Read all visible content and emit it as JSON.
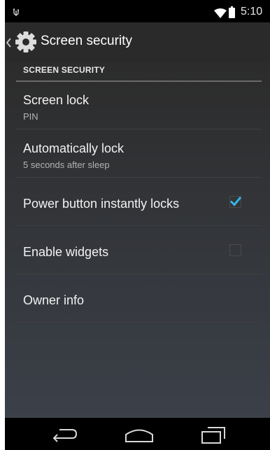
{
  "status_bar": {
    "time": "5:10",
    "icons": [
      "usb-icon",
      "wifi-icon",
      "battery-icon"
    ]
  },
  "action_bar": {
    "title": "Screen security",
    "icon": "gear-icon"
  },
  "section": {
    "header": "SCREEN SECURITY"
  },
  "items": [
    {
      "title": "Screen lock",
      "summary": "PIN"
    },
    {
      "title": "Automatically lock",
      "summary": "5 seconds after sleep"
    },
    {
      "title": "Power button instantly locks",
      "checked": true
    },
    {
      "title": "Enable widgets",
      "checked": false
    },
    {
      "title": "Owner info"
    }
  ],
  "nav_bar": {
    "buttons": [
      "back-icon",
      "home-icon",
      "recent-apps-icon"
    ]
  },
  "colors": {
    "accent": "#33b5e5",
    "action_bar": "#2a2a2a",
    "background_top": "#2c2c2c",
    "background_bottom": "#3b4049"
  }
}
